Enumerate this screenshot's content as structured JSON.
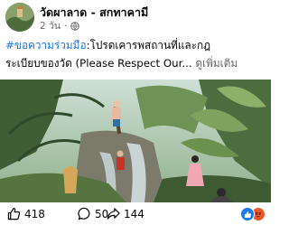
{
  "post": {
    "page_name": "วัดผาลาด - สกทาคามี",
    "time": "2 วัน",
    "dot": "·",
    "caption": {
      "hashtag": "#ขอความร่วมมือ",
      "line1_rest": ":โปรดเคารพสถานที่และกฎ",
      "line2": "ระเบียบของวัด (Please Respect Our...",
      "see_more": "ดูเพิ่มเติม"
    }
  },
  "stats": {
    "likes": "418",
    "comments": "50",
    "shares": "144"
  },
  "icons": {
    "privacy": "globe-icon",
    "like": "thumbs-up-icon",
    "comment": "comment-icon",
    "share": "share-icon",
    "reaction_1": "like-reaction-icon",
    "reaction_2": "angry-reaction-icon"
  },
  "colors": {
    "hashtag": "#1b74e4",
    "like_reaction": "#1877f2",
    "angry_reaction": "#f0582b",
    "secondary_text": "#65676b"
  }
}
